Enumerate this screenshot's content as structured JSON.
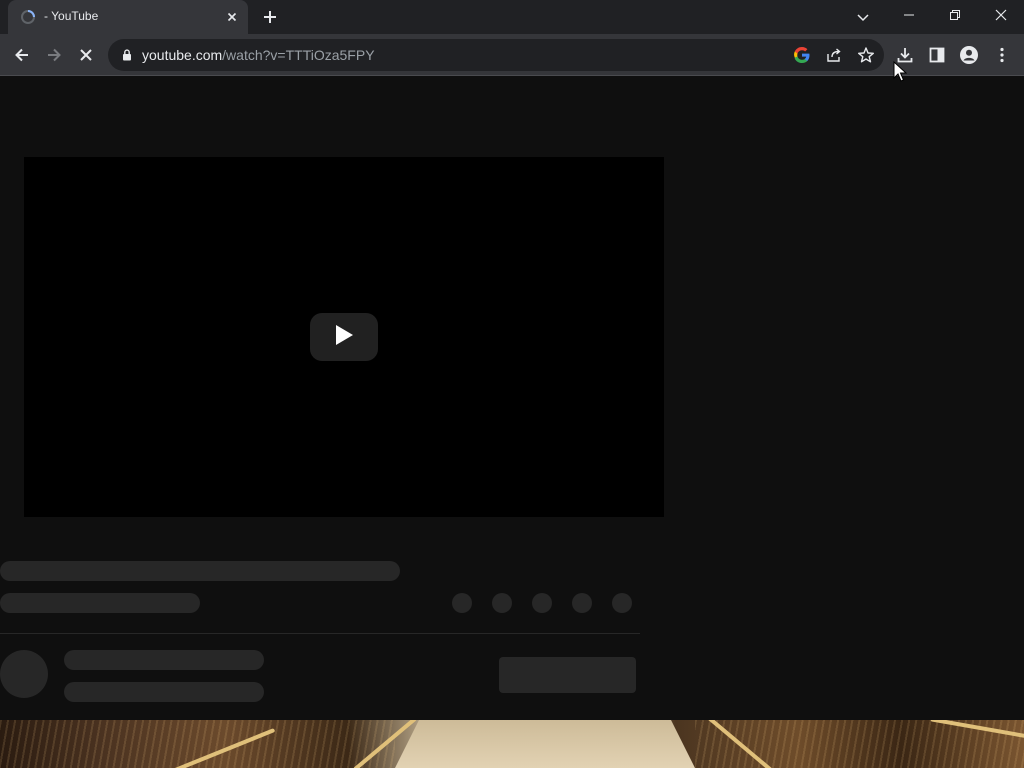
{
  "browser": {
    "tab": {
      "title": "- YouTube",
      "favicon": "loading-globe-icon",
      "close_icon": "close-icon"
    },
    "new_tab_icon": "plus-icon",
    "tab_search_icon": "chevron-down-icon",
    "window_controls": [
      "minimize-icon",
      "restore-icon",
      "close-icon"
    ],
    "toolbar": {
      "back_icon": "arrow-left-icon",
      "forward_icon": "arrow-right-icon",
      "stop_icon": "close-icon",
      "url_host": "youtube.com",
      "url_path": "/watch?v=TTTiOza5FPY",
      "omnibox_icons": [
        "google-icon",
        "share-icon",
        "star-icon"
      ],
      "right_icons": [
        "download-icon",
        "side-panel-icon",
        "profile-icon",
        "more-vertical-icon"
      ]
    }
  },
  "page": {
    "player": {
      "play_icon": "play-icon",
      "state": "loading"
    },
    "skeleton": {
      "action_button_placeholders": 5
    }
  },
  "colors": {
    "tabstrip": "#202124",
    "toolbar": "#35363a",
    "omnibox": "#202124",
    "page_bg": "#0f0f0f",
    "skeleton": "#272727",
    "text": "#e8eaed",
    "muted_text": "#9aa0a6"
  }
}
